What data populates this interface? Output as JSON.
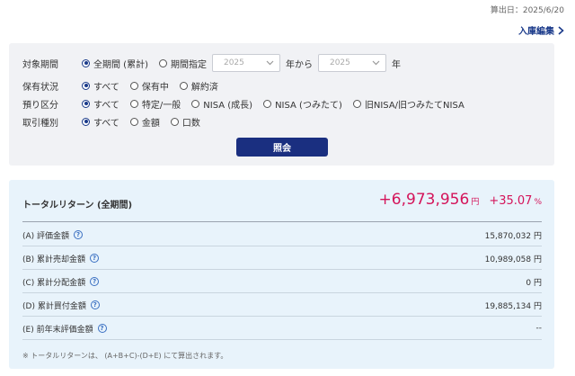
{
  "header": {
    "calc_date": "算出日：2025/6/20",
    "edit_link": "入庫編集"
  },
  "filters": {
    "period": {
      "label": "対象期間",
      "opt_all": "全期間 (累計)",
      "opt_specified": "期間指定",
      "select_from": "2025",
      "from_text": "年から",
      "select_to": "2025",
      "to_text": "年"
    },
    "holding": {
      "label": "保有状況",
      "options": [
        "すべて",
        "保有中",
        "解約済"
      ]
    },
    "deposit": {
      "label": "預り区分",
      "options": [
        "すべて",
        "特定/一般",
        "NISA (成長)",
        "NISA (つみたて)",
        "旧NISA/旧つみたてNISA"
      ]
    },
    "trade": {
      "label": "取引種別",
      "options": [
        "すべて",
        "金額",
        "口数"
      ]
    },
    "search_button": "照会"
  },
  "results": {
    "total_return_label": "トータルリターン (全期間)",
    "total_return_amount": "+6,973,956",
    "total_return_unit": "円",
    "total_return_pct": "+35.07",
    "total_return_pct_unit": "%",
    "rows": [
      {
        "label": "(A) 評価金額",
        "value": "15,870,032 円"
      },
      {
        "label": "(B) 累計売却金額",
        "value": "10,989,058 円"
      },
      {
        "label": "(C) 累計分配金額",
        "value": "0 円"
      },
      {
        "label": "(D) 累計買付金額",
        "value": "19,885,134 円"
      },
      {
        "label": "(E) 前年末評価金額",
        "value": "--"
      }
    ],
    "note": "※ トータルリターンは、 (A+B+C)-(D+E) にて算出されます。",
    "help_glyph": "?"
  },
  "colors": {
    "accent": "#1a2f80",
    "positive": "#d4145a",
    "filter_bg": "#f1f2f5",
    "result_bg": "#e8f3fb"
  },
  "icons": [
    "chevron-right-icon",
    "chevron-down-icon",
    "help-icon",
    "radio-icon"
  ]
}
